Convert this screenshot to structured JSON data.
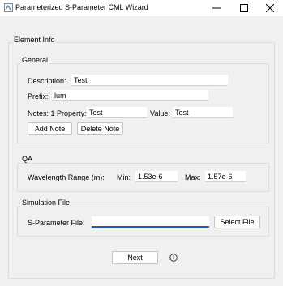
{
  "window": {
    "title": "Parameterized S-Parameter CML Wizard"
  },
  "element_info": {
    "title": "Element Info",
    "general": {
      "title": "General",
      "description_label": "Description:",
      "description_value": "Test",
      "prefix_label": "Prefix:",
      "prefix_value": "lum",
      "notes_label": "Notes: 1 Property:",
      "property_value": "Test",
      "value_label": "Value:",
      "value_value": "Test",
      "add_note_label": "Add Note",
      "delete_note_label": "Delete Note"
    },
    "qa": {
      "title": "QA",
      "wavelength_label": "Wavelength Range (m):",
      "min_label": "Min:",
      "min_value": "1.53e-6",
      "max_label": "Max:",
      "max_value": "1.57e-6"
    },
    "simulation_file": {
      "title": "Simulation File",
      "sparam_label": "S-Parameter File:",
      "sparam_value": "",
      "select_file_label": "Select File"
    }
  },
  "footer": {
    "next_label": "Next"
  }
}
